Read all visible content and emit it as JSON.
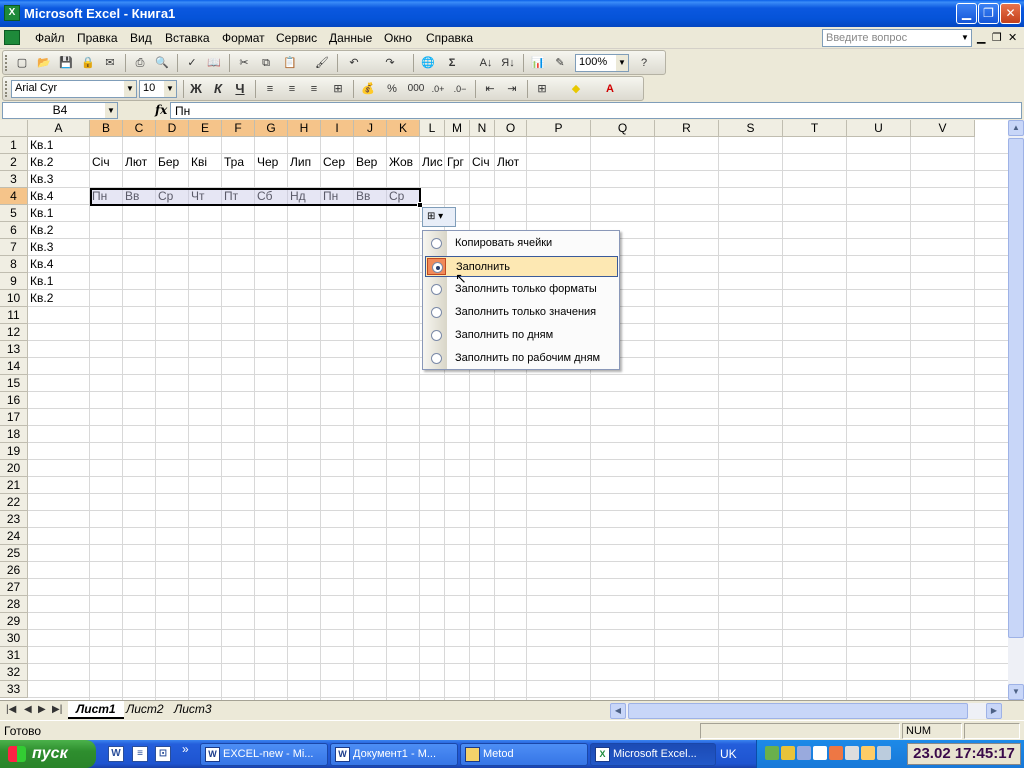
{
  "window": {
    "title": "Microsoft Excel - Книга1"
  },
  "menu": {
    "items": [
      "Файл",
      "Правка",
      "Вид",
      "Вставка",
      "Формат",
      "Сервис",
      "Данные",
      "Окно",
      "Справка"
    ],
    "help_placeholder": "Введите вопрос"
  },
  "toolbar": {
    "zoom": "100%",
    "font": "Arial Cyr",
    "size": "10",
    "bold": "Ж",
    "italic": "К",
    "underline": "Ч",
    "percent": "%",
    "thousands": "000",
    "sigma": "Σ"
  },
  "formula": {
    "cell_ref": "B4",
    "fx": "fx",
    "value": "Пн"
  },
  "grid": {
    "columns": [
      "A",
      "B",
      "C",
      "D",
      "E",
      "F",
      "G",
      "H",
      "I",
      "J",
      "K",
      "L",
      "M",
      "N",
      "O",
      "P",
      "Q",
      "R",
      "S",
      "T",
      "U",
      "V"
    ],
    "rows": [
      "1",
      "2",
      "3",
      "4",
      "5",
      "6",
      "7",
      "8",
      "9",
      "10",
      "11",
      "12",
      "13",
      "14",
      "15",
      "16",
      "17",
      "18",
      "19",
      "20",
      "21",
      "22",
      "23",
      "24",
      "25",
      "26",
      "27",
      "28",
      "29",
      "30",
      "31",
      "32",
      "33"
    ],
    "colA": [
      "Кв.1",
      "Кв.2",
      "Кв.3",
      "Кв.4",
      "Кв.1",
      "Кв.2",
      "Кв.3",
      "Кв.4",
      "Кв.1",
      "Кв.2"
    ],
    "row2": [
      "Січ",
      "Лют",
      "Бер",
      "Кві",
      "Тра",
      "Чер",
      "Лип",
      "Сер",
      "Вер",
      "Жов",
      "Лис",
      "Грг",
      "Січ",
      "Лют"
    ],
    "row4": [
      "Пн",
      "Вв",
      "Ср",
      "Чт",
      "Пт",
      "Сб",
      "Нд",
      "Пн",
      "Вв",
      "Ср"
    ]
  },
  "autofill": {
    "items": [
      "Копировать ячейки",
      "Заполнить",
      "Заполнить только форматы",
      "Заполнить только значения",
      "Заполнить по дням",
      "Заполнить по рабочим дням"
    ],
    "selected_index": 1
  },
  "sheets": {
    "tabs": [
      "Лист1",
      "Лист2",
      "Лист3"
    ],
    "active": "Лист1"
  },
  "status": {
    "text": "Готово",
    "num": "NUM"
  },
  "taskbar": {
    "start": "пуск",
    "tasks": [
      "EXCEL-new - Mi...",
      "Документ1 - М...",
      "Metod",
      "Microsoft Excel..."
    ],
    "lang": "UK",
    "clock": "23.02 17:45:17",
    "chevron": "»"
  },
  "colors": {
    "selected_header": "#f5c48a",
    "title_bar": "#0553d8",
    "highlight_item": "#fde8b3"
  }
}
